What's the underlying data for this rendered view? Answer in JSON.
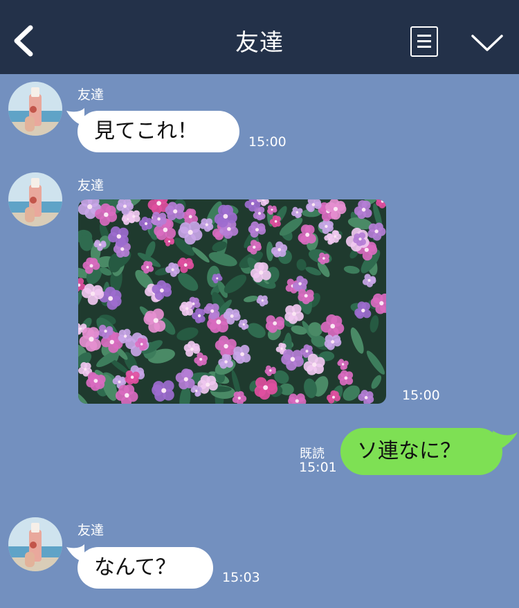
{
  "header": {
    "title": "友達",
    "back_icon": "chevron-left-icon",
    "menu_icon": "note-list-icon",
    "expand_icon": "chevron-down-icon"
  },
  "messages": [
    {
      "sender": "友達",
      "text": "見てこれ！",
      "time": "15:00"
    },
    {
      "sender": "友達",
      "type": "image",
      "image": "flower-photo",
      "time": "15:00"
    },
    {
      "sender": "me",
      "text": "ソ連なに？",
      "read": "既読",
      "time": "15:01"
    },
    {
      "sender": "友達",
      "text": "なんて？",
      "time": "15:03"
    }
  ],
  "colors": {
    "header_bg": "#233149",
    "chat_bg": "#7390bf",
    "outgoing_bubble": "#7ee054",
    "incoming_bubble": "#ffffff"
  }
}
